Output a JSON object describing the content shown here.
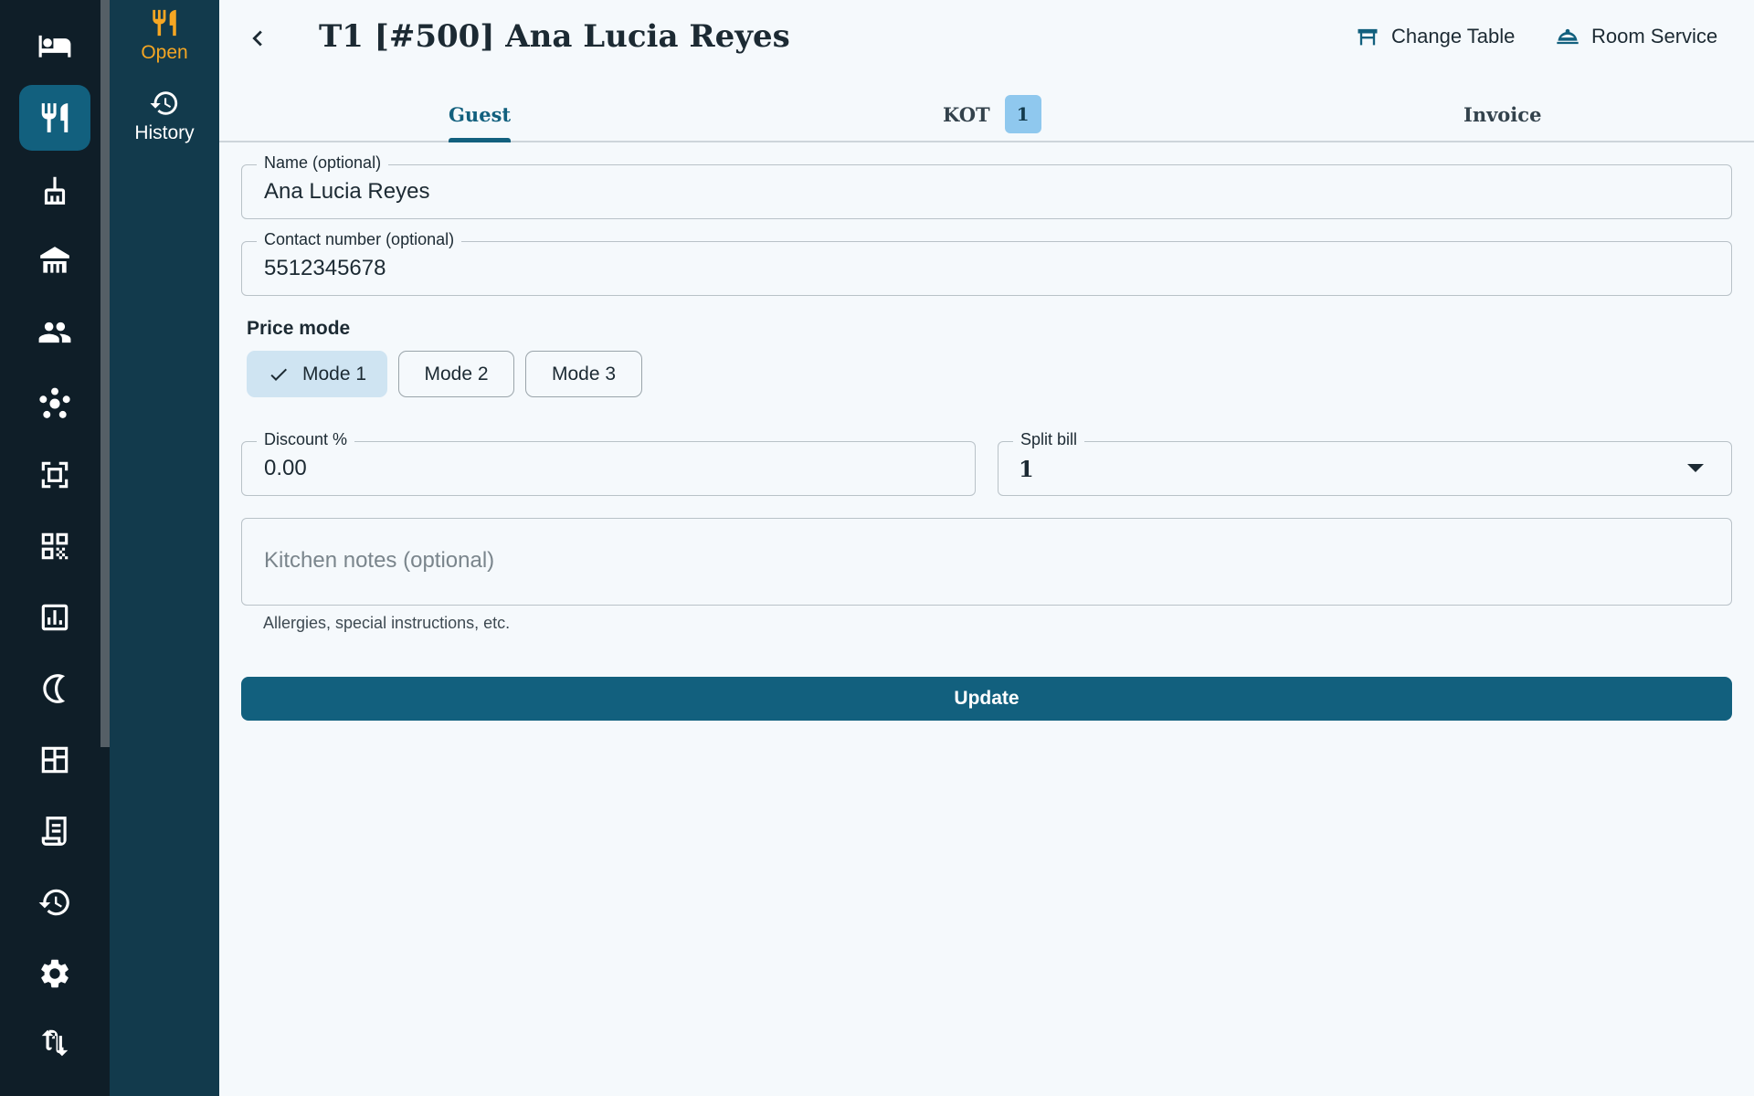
{
  "rail": {
    "items": [
      {
        "icon": "bed-icon",
        "active": false
      },
      {
        "icon": "restaurant-icon",
        "active": true
      },
      {
        "icon": "housekeeping-icon",
        "active": false
      },
      {
        "icon": "property-icon",
        "active": false
      },
      {
        "icon": "people-icon",
        "active": false
      },
      {
        "icon": "hub-icon",
        "active": false
      },
      {
        "icon": "scanner-icon",
        "active": false
      },
      {
        "icon": "qr-code-icon",
        "active": false
      },
      {
        "icon": "analytics-icon",
        "active": false
      },
      {
        "icon": "night-audit-icon",
        "active": false
      },
      {
        "icon": "layout-icon",
        "active": false
      },
      {
        "icon": "receipt-icon",
        "active": false
      },
      {
        "icon": "history-icon",
        "active": false
      },
      {
        "icon": "settings-icon",
        "active": false
      },
      {
        "icon": "sync-icon",
        "active": false
      }
    ]
  },
  "subnav": {
    "open_label": "Open",
    "history_label": "History"
  },
  "header": {
    "title": "T1 [#500] Ana Lucia Reyes",
    "change_table_label": "Change Table",
    "room_service_label": "Room Service"
  },
  "tabs": {
    "guest": "Guest",
    "kot": "KOT",
    "kot_count": "1",
    "invoice": "Invoice",
    "active": "guest"
  },
  "form": {
    "name_label": "Name (optional)",
    "name_value": "Ana Lucia Reyes",
    "contact_label": "Contact number (optional)",
    "contact_value": "5512345678",
    "price_mode_label": "Price mode",
    "modes": [
      "Mode 1",
      "Mode 2",
      "Mode 3"
    ],
    "selected_mode": "Mode 1",
    "discount_label": "Discount %",
    "discount_value": "0.00",
    "split_label": "Split bill",
    "split_value": "1",
    "notes_placeholder": "Kitchen notes (optional)",
    "notes_helper": "Allergies, special instructions, etc.",
    "update_label": "Update"
  },
  "colors": {
    "primary": "#12607e",
    "rail_bg": "#0f1e28",
    "subnav_bg": "#123a4c",
    "accent": "#f5a623",
    "badge_bg": "#8fc8ee",
    "selected_chip_bg": "#cfe4f2"
  }
}
